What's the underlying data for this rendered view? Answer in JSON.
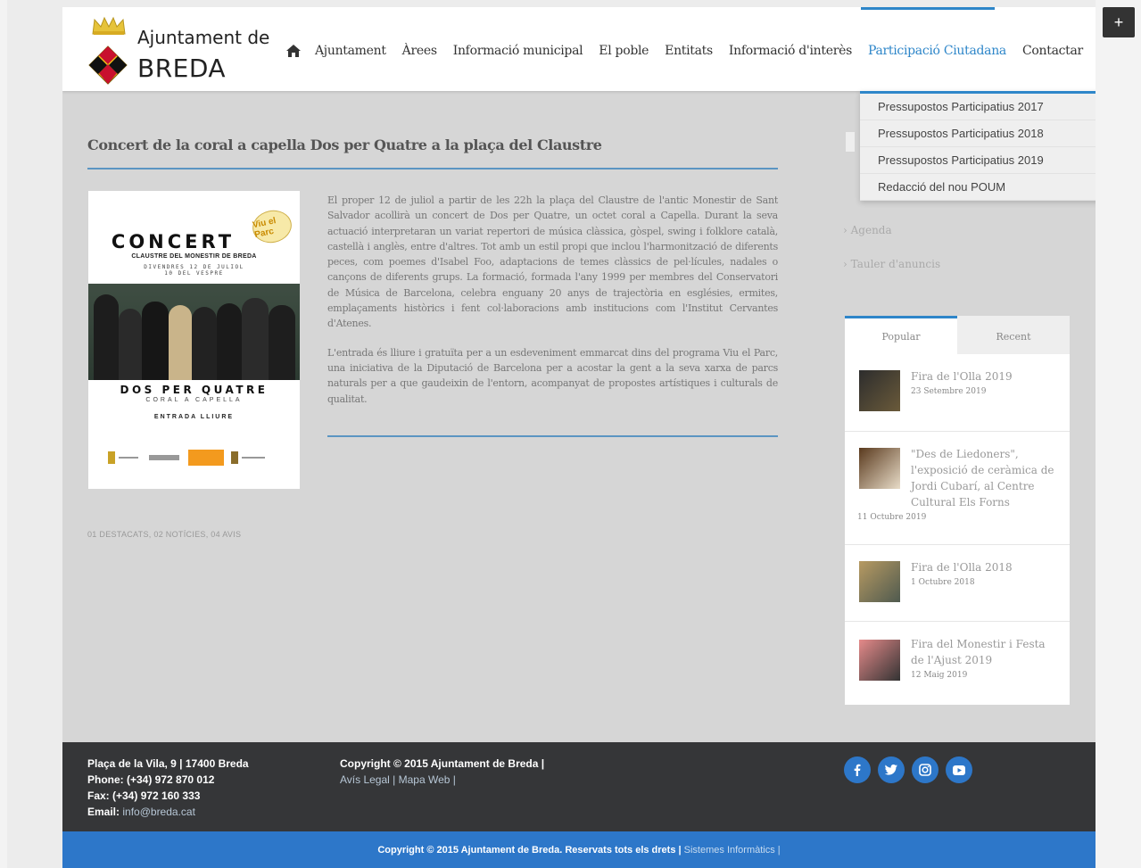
{
  "brand": {
    "line1": "Ajuntament de",
    "line2": "BREDA"
  },
  "nav": {
    "items": [
      {
        "label": "Ajuntament"
      },
      {
        "label": "Àrees"
      },
      {
        "label": "Informació municipal"
      },
      {
        "label": "El poble"
      },
      {
        "label": "Entitats"
      },
      {
        "label": "Informació d'interès"
      },
      {
        "label": "Participació Ciutadana"
      },
      {
        "label": "Contactar"
      }
    ],
    "active": "Participació Ciutadana"
  },
  "dropdown": {
    "items": [
      {
        "label": "Pressupostos Participatius 2017"
      },
      {
        "label": "Pressupostos Participatius 2018"
      },
      {
        "label": "Pressupostos Participatius 2019"
      },
      {
        "label": "Redacció del nou POUM"
      }
    ]
  },
  "toggle": {
    "label": "+"
  },
  "post": {
    "title": "Concert de la coral a capella Dos per Quatre a la plaça del Claustre",
    "paragraphs": [
      "El proper 12 de juliol a partir de les 22h la plaça del Claustre de l'antic Monestir de Sant Salvador acollirà un concert de Dos per Quatre, un octet coral a Capella. Durant la seva actuació interpretaran un variat repertori de música clàssica, gòspel, swing i folklore català, castellà i anglès, entre d'altres. Tot amb un estil propi que inclou l'harmonització de diferents peces, com poemes d'Isabel Foo, adaptacions de temes clàssics de pel·lícules, nadales o cançons de diferents grups. La formació, formada l'any 1999 per membres del Conservatori de Música de Barcelona, celebra enguany 20 anys de trajectòria en esglésies, ermites, emplaçaments històrics i fent col·laboracions amb institucions com l'Institut Cervantes d'Atenes.",
      "L'entrada és lliure i gratuïta per a un esdeveniment emmarcat dins del programa Viu el Parc, una iniciativa de la Diputació de Barcelona per a acostar la gent a la seva xarxa de parcs naturals per a que gaudeixin de l'entorn, acompanyat de propostes artístiques i culturals de qualitat."
    ],
    "tags": "01 DESTACATS, 02 NOTÍCIES, 04 AVIS",
    "poster": {
      "heading": "CONCERT",
      "subheading": "CLAUSTRE DEL MONESTIR DE BREDA",
      "date": "DIVENDRES 12 DE JULIOL",
      "time": "10 DEL VESPRE",
      "badge": "Viu el Parc",
      "group": "DOS PER QUATRE",
      "group_sub": "CORAL A CAPELLA",
      "entry": "ENTRADA LLIURE"
    }
  },
  "sidebar": {
    "links": [
      {
        "label": "Agenda"
      },
      {
        "label": "Tauler d'anuncis"
      }
    ],
    "tabs": [
      {
        "label": "Popular"
      },
      {
        "label": "Recent"
      }
    ],
    "posts": [
      {
        "title": "Fira de l'Olla 2019",
        "date": "23 Setembre 2019"
      },
      {
        "title": "\"Des de Liedoners\", l'exposició de ceràmica de Jordi Cubarí, al Centre Cultural Els Forns",
        "date": "11 Octubre 2019"
      },
      {
        "title": "Fira de l'Olla 2018",
        "date": "1 Octubre 2018"
      },
      {
        "title": "Fira del Monestir i Festa de l'Ajust 2019",
        "date": "12 Maig 2019"
      }
    ]
  },
  "footer": {
    "address": "Plaça de la Vila, 9 | 17400 Breda",
    "phone": "Phone: (+34) 972 870 012",
    "fax": "Fax: (+34) 972 160 333",
    "email_label": "Email:",
    "email": "info@breda.cat",
    "copyright": "Copyright © 2015 Ajuntament de Breda |",
    "legal": "Avís Legal | Mapa Web |",
    "bottom_text": "Copyright © 2015 Ajuntament de Breda. Reservats tots els drets |",
    "bottom_link": "Sistemes Informàtics |",
    "social": [
      "facebook-icon",
      "twitter-icon",
      "instagram-icon",
      "youtube-icon"
    ]
  },
  "colors": {
    "accent": "#2e86c9",
    "footer_dark": "#353638",
    "footer_blue": "#2d77c9"
  }
}
